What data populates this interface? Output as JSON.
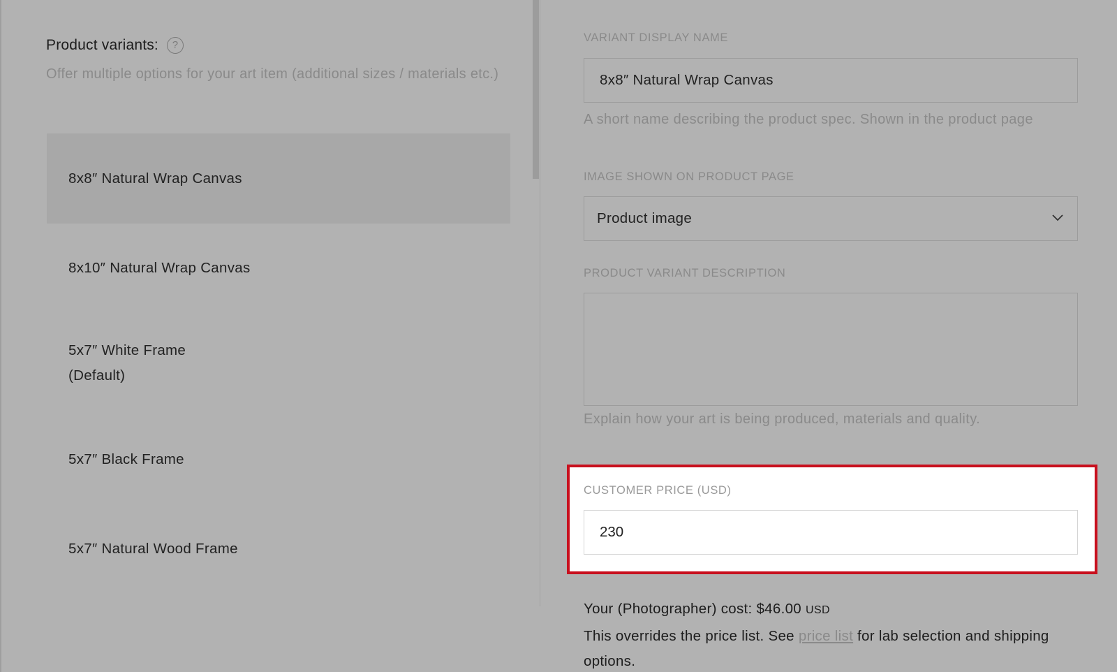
{
  "left": {
    "title": "Product variants:",
    "help_icon_glyph": "?",
    "description": "Offer multiple options for your art item (additional sizes / materials etc.)",
    "variants": [
      {
        "label": "8x8″ Natural Wrap Canvas",
        "selected": true
      },
      {
        "label": "8x10″ Natural Wrap Canvas",
        "selected": false
      },
      {
        "label": "5x7″ White Frame",
        "sub": "(Default)",
        "selected": false
      },
      {
        "label": "5x7″ Black Frame",
        "selected": false
      },
      {
        "label": "5x7″ Natural Wood Frame",
        "selected": false
      }
    ]
  },
  "form": {
    "display_name": {
      "label": "VARIANT DISPLAY NAME",
      "value": "8x8″ Natural Wrap Canvas",
      "helper": "A short name describing the product spec. Shown in the product page"
    },
    "image": {
      "label": "IMAGE SHOWN ON PRODUCT PAGE",
      "value": "Product image"
    },
    "description": {
      "label": "PRODUCT VARIANT DESCRIPTION",
      "value": "",
      "helper": "Explain how your art is being produced, materials and quality."
    },
    "price": {
      "label": "CUSTOMER PRICE (USD)",
      "value": "230"
    },
    "cost": {
      "prefix": "Your (Photographer) cost: $46.00",
      "unit": "USD"
    },
    "override": {
      "before": "This overrides the price list. See ",
      "link": "price list",
      "after": " for lab selection and shipping options."
    }
  },
  "colors": {
    "overlay_gray": "#b2b2b2",
    "highlight_red": "#c8101e",
    "selected_item": "#a8a8a8"
  },
  "icons": {
    "help": "help-circle-icon",
    "dropdown": "chevron-down-icon"
  }
}
